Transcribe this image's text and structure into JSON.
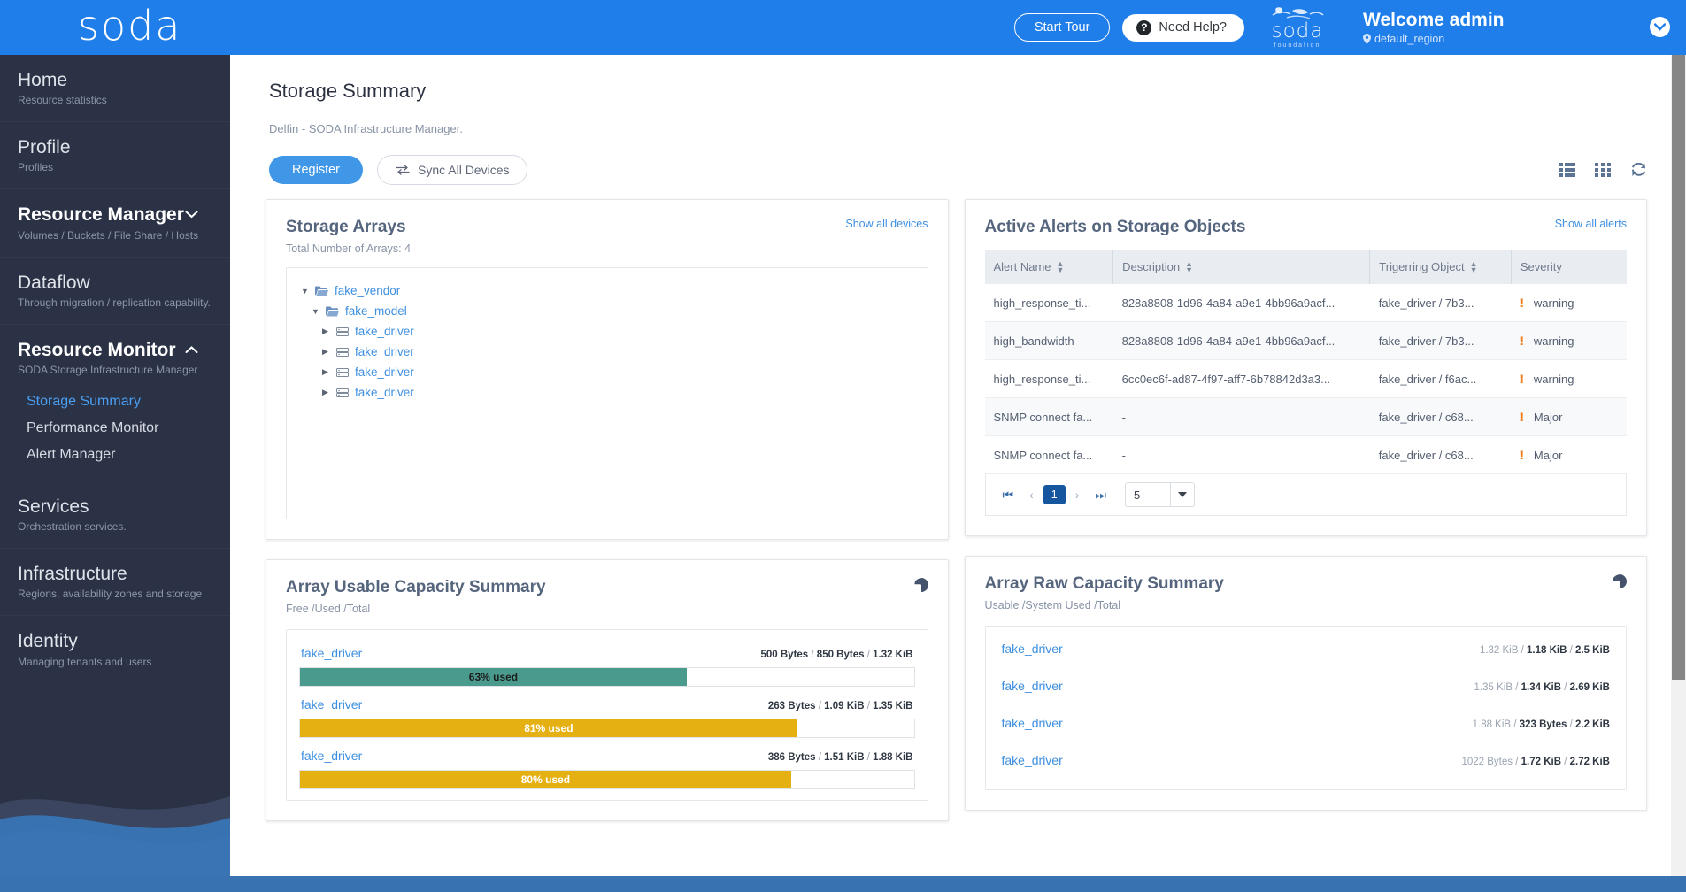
{
  "header": {
    "logo": "soda",
    "start_tour": "Start Tour",
    "need_help": "Need Help?",
    "help_icon": "question-mark-icon",
    "foundation_name": "soda",
    "foundation_sub": "foundation",
    "welcome": "Welcome admin",
    "region": "default_region",
    "region_icon": "location-pin-icon",
    "account_caret": "chevron-down-icon"
  },
  "sidebar": {
    "items": [
      {
        "label": "Home",
        "sub": "Resource statistics",
        "bold": false,
        "caret": ""
      },
      {
        "label": "Profile",
        "sub": "Profiles",
        "bold": false,
        "caret": ""
      },
      {
        "label": "Resource Manager",
        "sub": "Volumes / Buckets / File Share / Hosts",
        "bold": true,
        "caret": "chevron-down"
      },
      {
        "label": "Dataflow",
        "sub": "Through migration / replication capability.",
        "bold": false,
        "caret": ""
      },
      {
        "label": "Resource Monitor",
        "sub": "SODA Storage Infrastructure Manager",
        "bold": true,
        "caret": "chevron-up"
      },
      {
        "label": "Services",
        "sub": "Orchestration services.",
        "bold": false,
        "caret": ""
      },
      {
        "label": "Infrastructure",
        "sub": "Regions, availability zones and storage",
        "bold": false,
        "caret": ""
      },
      {
        "label": "Identity",
        "sub": "Managing tenants and users",
        "bold": false,
        "caret": ""
      }
    ],
    "submenu": [
      {
        "label": "Storage Summary",
        "active": true
      },
      {
        "label": "Performance Monitor",
        "active": false
      },
      {
        "label": "Alert Manager",
        "active": false
      }
    ]
  },
  "page": {
    "title": "Storage Summary",
    "subtitle": "Delfin - SODA Infrastructure Manager.",
    "register_label": "Register",
    "sync_label": "Sync All Devices",
    "sync_icon": "sync-arrows-icon",
    "view_list_icon": "list-view-icon",
    "view_grid_icon": "grid-view-icon",
    "refresh_icon": "refresh-icon"
  },
  "storage_arrays": {
    "title": "Storage Arrays",
    "link": "Show all devices",
    "total_label": "Total Number of Arrays: 4",
    "tree": [
      {
        "label": "fake_vendor",
        "level": 1,
        "icon": "folder-open-icon",
        "expanded": true
      },
      {
        "label": "fake_model",
        "level": 2,
        "icon": "folder-open-icon",
        "expanded": true
      },
      {
        "label": "fake_driver",
        "level": 3,
        "icon": "storage-array-icon",
        "expanded": false
      },
      {
        "label": "fake_driver",
        "level": 3,
        "icon": "storage-array-icon",
        "expanded": false
      },
      {
        "label": "fake_driver",
        "level": 3,
        "icon": "storage-array-icon",
        "expanded": false
      },
      {
        "label": "fake_driver",
        "level": 3,
        "icon": "storage-array-icon",
        "expanded": false
      }
    ]
  },
  "alerts": {
    "title": "Active Alerts on Storage Objects",
    "link": "Show all alerts",
    "columns": [
      "Alert Name",
      "Description",
      "Trigerring Object",
      "Severity"
    ],
    "rows": [
      {
        "name": "high_response_ti...",
        "description": "828a8808-1d96-4a84-a9e1-4bb96a9acf...",
        "object": "fake_driver / 7b3...",
        "severity": "warning"
      },
      {
        "name": "high_bandwidth",
        "description": "828a8808-1d96-4a84-a9e1-4bb96a9acf...",
        "object": "fake_driver / 7b3...",
        "severity": "warning"
      },
      {
        "name": "high_response_ti...",
        "description": "6cc0ec6f-ad87-4f97-aff7-6b78842d3a3...",
        "object": "fake_driver / f6ac...",
        "severity": "warning"
      },
      {
        "name": "SNMP connect fa...",
        "description": "-",
        "object": "fake_driver / c68...",
        "severity": "Major"
      },
      {
        "name": "SNMP connect fa...",
        "description": "-",
        "object": "fake_driver / c68...",
        "severity": "Major"
      }
    ],
    "pager": {
      "first_icon": "first-page-icon",
      "prev_icon": "prev-page-icon",
      "current_page": "1",
      "next_icon": "next-page-icon",
      "last_icon": "last-page-icon",
      "page_size": "5"
    }
  },
  "usable_capacity": {
    "title": "Array Usable Capacity Summary",
    "subtitle": "Free /Used /Total",
    "chart_icon": "pie-chart-icon",
    "rows": [
      {
        "name": "fake_driver",
        "free": "500 Bytes",
        "used": "850 Bytes",
        "total": "1.32 KiB",
        "percent": 63,
        "label": "63% used",
        "color": "#4a9b8e"
      },
      {
        "name": "fake_driver",
        "free": "263 Bytes",
        "used": "1.09 KiB",
        "total": "1.35 KiB",
        "percent": 81,
        "label": "81% used",
        "color": "#e5b011"
      },
      {
        "name": "fake_driver",
        "free": "386 Bytes",
        "used": "1.51 KiB",
        "total": "1.88 KiB",
        "percent": 80,
        "label": "80% used",
        "color": "#e5b011"
      }
    ]
  },
  "raw_capacity": {
    "title": "Array Raw Capacity Summary",
    "subtitle": "Usable /System Used /Total",
    "chart_icon": "pie-chart-icon",
    "rows": [
      {
        "name": "fake_driver",
        "usable": "1.32 KiB",
        "system_used": "1.18 KiB",
        "total": "2.5 KiB"
      },
      {
        "name": "fake_driver",
        "usable": "1.35 KiB",
        "system_used": "1.34 KiB",
        "total": "2.69 KiB"
      },
      {
        "name": "fake_driver",
        "usable": "1.88 KiB",
        "system_used": "323 Bytes",
        "total": "2.2 KiB"
      },
      {
        "name": "fake_driver",
        "usable": "1022 Bytes",
        "system_used": "1.72 KiB",
        "total": "2.72 KiB"
      }
    ]
  },
  "chart_data": {
    "type": "bar",
    "title": "Array Usable Capacity Summary",
    "subtitle": "Free /Used /Total",
    "categories": [
      "fake_driver",
      "fake_driver",
      "fake_driver"
    ],
    "values": [
      63,
      81,
      80
    ],
    "ylabel": "% used",
    "ylim": [
      0,
      100
    ],
    "grid": false,
    "legend": "none"
  },
  "colors": {
    "brand_blue": "#1f7eea",
    "sidebar": "#2b3245",
    "link": "#3e8fe0",
    "teal": "#4a9b8e",
    "amber": "#e5b011",
    "severity_orange": "#f07d1a",
    "pager_active": "#16569e"
  }
}
